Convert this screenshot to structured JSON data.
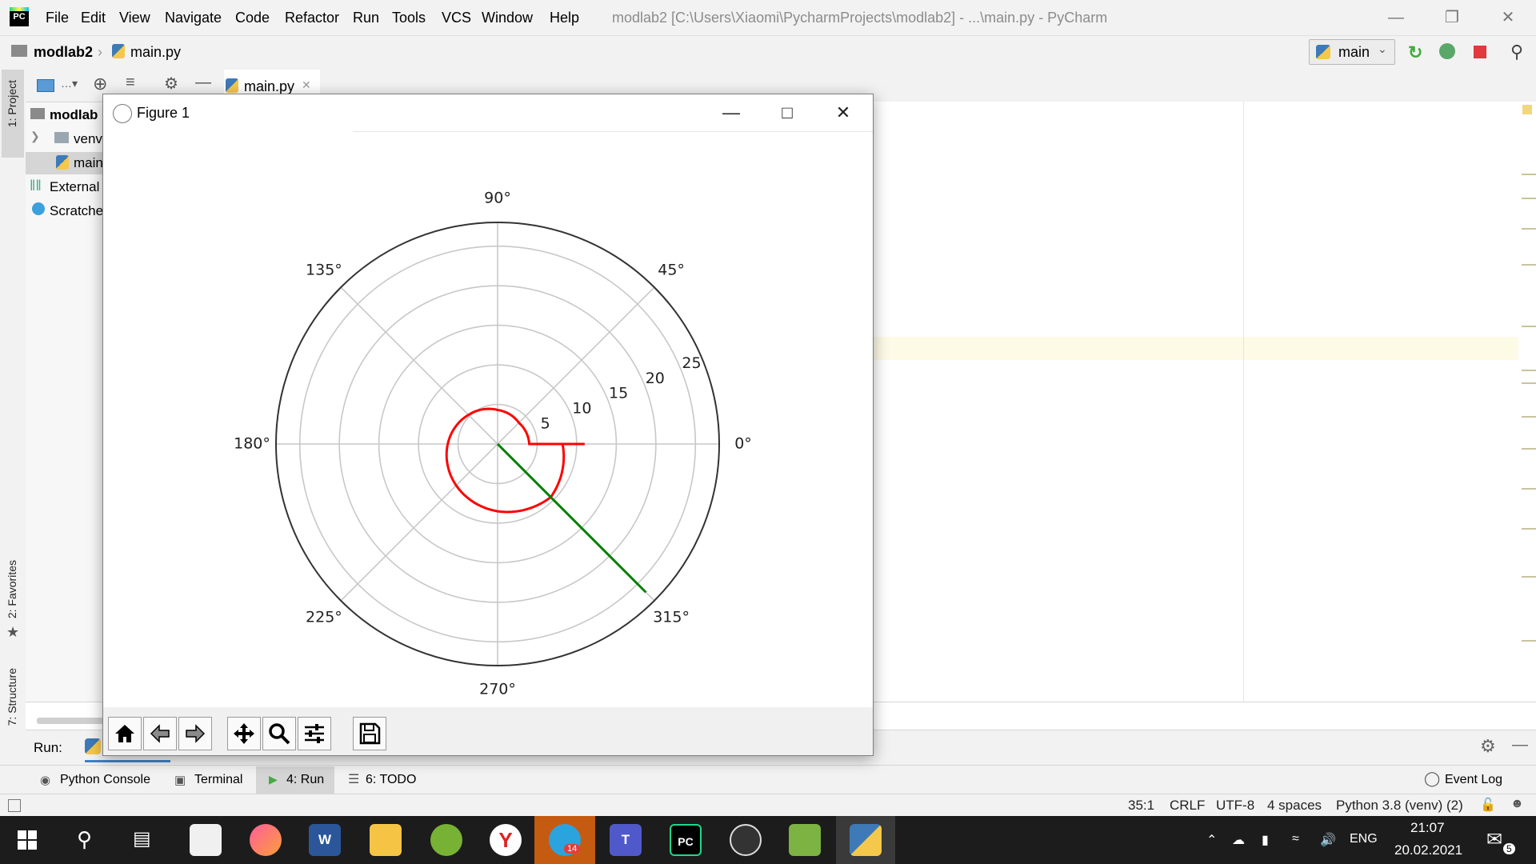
{
  "menubar": {
    "items": [
      "File",
      "Edit",
      "View",
      "Navigate",
      "Code",
      "Refactor",
      "Run",
      "Tools",
      "VCS",
      "Window",
      "Help"
    ],
    "window_title": "modlab2 [C:\\Users\\Xiaomi\\PycharmProjects\\modlab2] - ...\\main.py - PyCharm"
  },
  "navbar": {
    "project": "modlab2",
    "file": "main.py",
    "run_config": "main"
  },
  "left_strip": {
    "project_tab": "1: Project",
    "favorites_tab": "2: Favorites",
    "structure_tab": "7: Structure"
  },
  "project_tree": {
    "root": "modlab",
    "venv": "venv",
    "main": "main",
    "external": "External",
    "scratches": "Scratche"
  },
  "editor": {
    "tab_label": "main.py"
  },
  "figure": {
    "title": "Figure 1"
  },
  "chart_data": {
    "type": "line",
    "projection": "polar",
    "angle_ticks": [
      "0°",
      "45°",
      "90°",
      "135°",
      "180°",
      "225°",
      "270°",
      "315°"
    ],
    "radial_ticks": [
      "5",
      "10",
      "15",
      "20",
      "25"
    ],
    "rmax": 28,
    "grid": true,
    "series": [
      {
        "color": "#ff0000",
        "kind": "spiral",
        "theta_deg": [
          0,
          45,
          90,
          135,
          180,
          225,
          270,
          315,
          360
        ],
        "r": [
          11,
          3.8,
          4.3,
          5.2,
          6.3,
          7.4,
          8.5,
          9.5,
          8.2
        ]
      },
      {
        "color": "#008000",
        "kind": "ray",
        "theta_deg": [
          315,
          315
        ],
        "r": [
          0,
          26.5
        ]
      }
    ]
  },
  "run_panel": {
    "label": "Run:"
  },
  "tool_windows": {
    "python_console": "Python Console",
    "terminal": "Terminal",
    "run": "4: Run",
    "todo": "6: TODO",
    "event_log": "Event Log"
  },
  "status": {
    "position": "35:1",
    "line_sep": "CRLF",
    "encoding": "UTF-8",
    "indent": "4 spaces",
    "interpreter": "Python 3.8 (venv) (2)"
  },
  "taskbar": {
    "language": "ENG",
    "time": "21:07",
    "date": "20.02.2021",
    "telegram_badge": "14",
    "notification_count": "5"
  }
}
